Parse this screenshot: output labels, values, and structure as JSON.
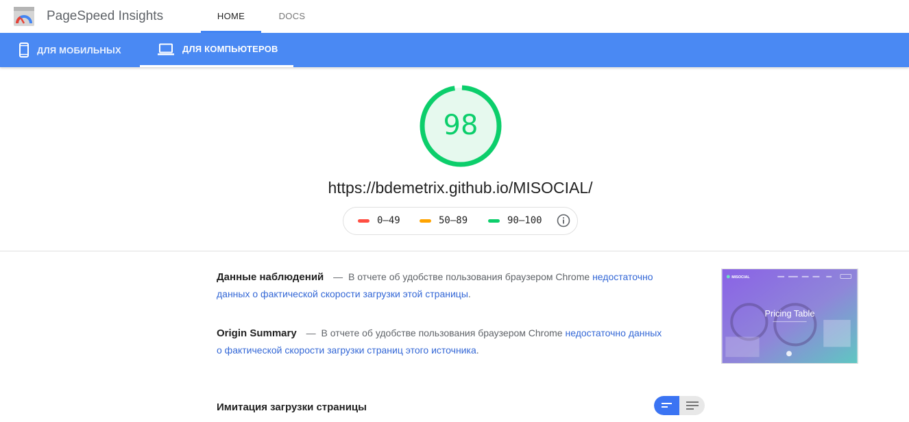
{
  "header": {
    "brand": "PageSpeed Insights",
    "nav": [
      {
        "label": "HOME",
        "active": true
      },
      {
        "label": "DOCS",
        "active": false
      }
    ]
  },
  "device_tabs": [
    {
      "label": "ДЛЯ МОБИЛЬНЫХ",
      "icon": "phone-icon",
      "active": false
    },
    {
      "label": "ДЛЯ КОМПЬЮТЕРОВ",
      "icon": "laptop-icon",
      "active": true
    }
  ],
  "score": {
    "value": "98",
    "fraction": 0.98,
    "color": "#0cce6b"
  },
  "url": "https://bdemetrix.github.io/MISOCIAL/",
  "legend": [
    {
      "range": "0–49",
      "color": "#ff4e42"
    },
    {
      "range": "50–89",
      "color": "#ffa400"
    },
    {
      "range": "90–100",
      "color": "#0cce6b"
    }
  ],
  "field_data": {
    "title": "Данные наблюдений",
    "dash": "—",
    "text": "В отчете об удобстве пользования браузером Chrome",
    "link": "недостаточно данных о фактической скорости загрузки этой страницы",
    "end": "."
  },
  "origin_summary": {
    "title": "Origin Summary",
    "dash": "—",
    "text": "В отчете об удобстве пользования браузером Chrome",
    "link": "недостаточно данных о фактической скорости загрузки страниц этого источника",
    "end": "."
  },
  "thumbnail": {
    "brand": "MISOCIAL",
    "heading": "Pricing Table"
  },
  "lab_data": {
    "title": "Имитация загрузки страницы"
  },
  "colors": {
    "accent": "#4285f4",
    "device_bar": "#4a89f3",
    "link": "#3367d6",
    "pass": "#0cce6b"
  }
}
